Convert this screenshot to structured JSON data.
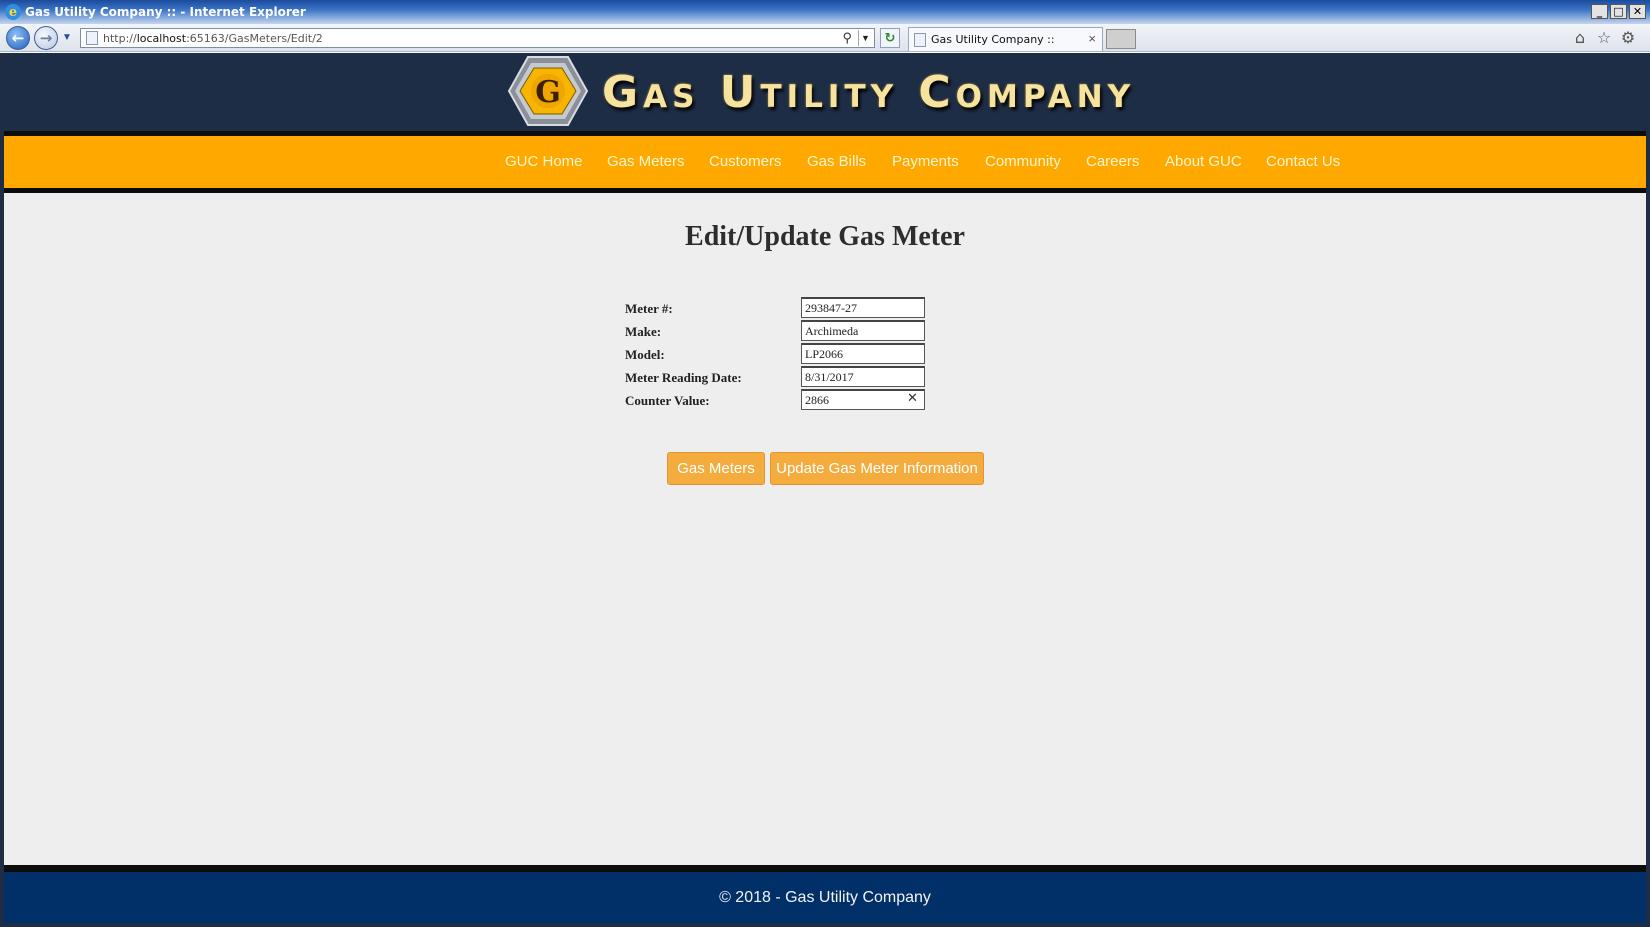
{
  "window": {
    "title": "Gas Utility Company :: - Internet Explorer",
    "controls": {
      "minimize": "_",
      "maximize": "□",
      "close": "✕"
    }
  },
  "browser": {
    "url_prefix": "http://",
    "url_host": "localhost",
    "url_rest": ":65163/GasMeters/Edit/2",
    "tab_title": "Gas Utility Company ::",
    "icons": [
      "back-icon",
      "forward-icon",
      "search-icon",
      "refresh-icon",
      "home-icon",
      "favorites-star-icon",
      "settings-gear-icon"
    ]
  },
  "site": {
    "logo_letter": "G",
    "brand_name": "Gas Utility Company",
    "menu": [
      "GUC Home",
      "Gas Meters",
      "Customers",
      "Gas Bills",
      "Payments",
      "Community",
      "Careers",
      "About GUC",
      "Contact Us"
    ],
    "footer": "© 2018 - Gas Utility Company",
    "colors": {
      "header": "#1e2d46",
      "menu_bar": "#ffa800",
      "menu_text": "#fff6cc",
      "button": "#f4ac3e",
      "footer": "#013069",
      "content_bg": "#eeeeee"
    }
  },
  "page": {
    "title": "Edit/Update Gas Meter",
    "fields": [
      {
        "label": "Meter #:",
        "value": "293847-27"
      },
      {
        "label": "Make:",
        "value": "Archimeda"
      },
      {
        "label": "Model:",
        "value": "LP2066"
      },
      {
        "label": "Meter Reading Date:",
        "value": "8/31/2017"
      },
      {
        "label": "Counter Value:",
        "value": "2866"
      }
    ],
    "buttons": {
      "back": "Gas Meters",
      "submit": "Update Gas Meter Information"
    }
  }
}
